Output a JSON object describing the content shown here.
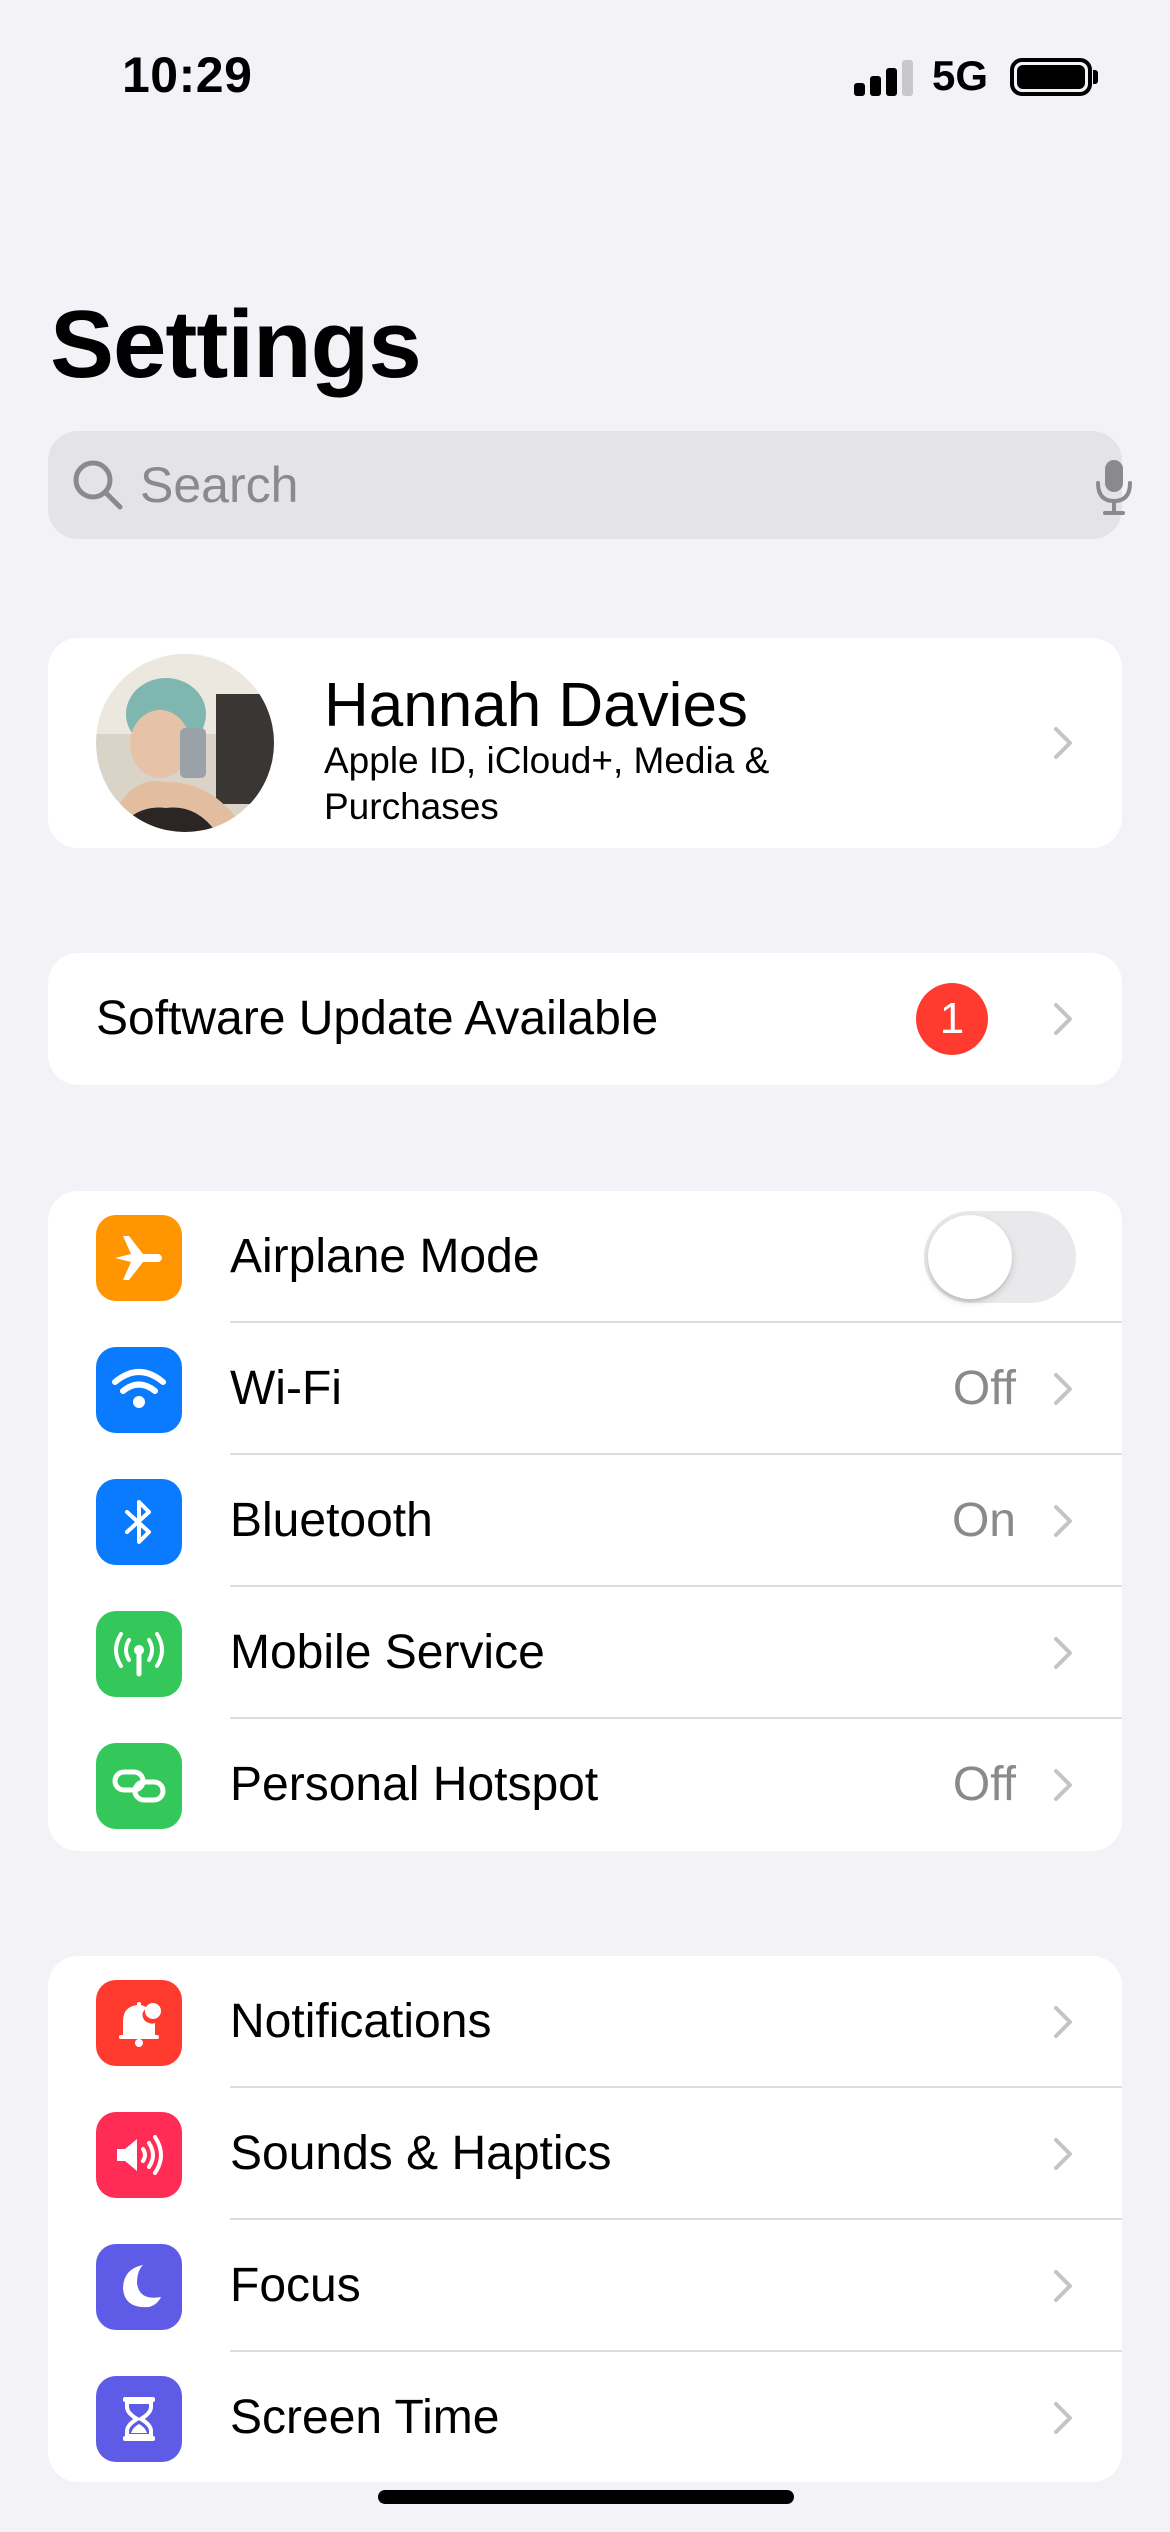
{
  "status_bar": {
    "time": "10:29",
    "network": "5G"
  },
  "page": {
    "title": "Settings"
  },
  "search": {
    "placeholder": "Search"
  },
  "profile": {
    "name": "Hannah Davies",
    "subtitle": "Apple ID, iCloud+, Media & Purchases"
  },
  "update": {
    "label": "Software Update Available",
    "badge": "1"
  },
  "network_group": [
    {
      "label": "Airplane Mode",
      "icon": "airplane-icon",
      "color": "#ff9500",
      "toggle": false
    },
    {
      "label": "Wi-Fi",
      "icon": "wifi-icon",
      "color": "#0a7aff",
      "value": "Off"
    },
    {
      "label": "Bluetooth",
      "icon": "bluetooth-icon",
      "color": "#0a7aff",
      "value": "On"
    },
    {
      "label": "Mobile Service",
      "icon": "antenna-icon",
      "color": "#34c759",
      "value": ""
    },
    {
      "label": "Personal Hotspot",
      "icon": "hotspot-icon",
      "color": "#34c759",
      "value": "Off"
    }
  ],
  "general_group": [
    {
      "label": "Notifications",
      "icon": "bell-icon",
      "color": "#ff3b30"
    },
    {
      "label": "Sounds & Haptics",
      "icon": "speaker-icon",
      "color": "#ff2d55"
    },
    {
      "label": "Focus",
      "icon": "moon-icon",
      "color": "#5e5ce6"
    },
    {
      "label": "Screen Time",
      "icon": "hourglass-icon",
      "color": "#5e5ce6"
    }
  ]
}
